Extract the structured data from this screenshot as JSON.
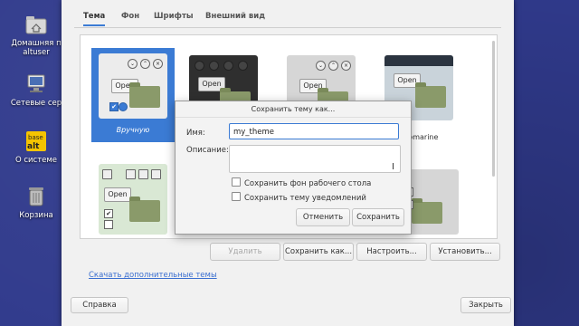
{
  "desktop": {
    "icons": [
      {
        "label": "Домашняя п",
        "label2": "altuser",
        "icon": "home-folder-icon"
      },
      {
        "label": "Сетевые сер",
        "icon": "network-icon"
      },
      {
        "label": "О системе",
        "icon": "basealt-logo-icon",
        "logo_text": "base alt"
      },
      {
        "label": "Корзина",
        "icon": "trash-icon"
      }
    ]
  },
  "tabs": [
    {
      "label": "Тема",
      "active": true
    },
    {
      "label": "Фон"
    },
    {
      "label": "Шрифты"
    },
    {
      "label": "Внешний вид"
    }
  ],
  "themes": [
    {
      "name": "Вручную",
      "selected": true,
      "open_label": "Open"
    },
    {
      "name": "",
      "open_label": "Open"
    },
    {
      "name": "",
      "open_label": "Open"
    },
    {
      "name": "Submarine",
      "open_label": "Open"
    },
    {
      "name": "",
      "open_label": "Open"
    }
  ],
  "actions": {
    "delete": "Удалить",
    "save_as": "Сохранить как...",
    "customize": "Настроить...",
    "install": "Установить..."
  },
  "more_themes_link": "Скачать дополнительные темы",
  "footer": {
    "help": "Справка",
    "close": "Закрыть"
  },
  "dialog": {
    "title": "Сохранить тему как...",
    "name_label": "Имя:",
    "name_value": "my_theme",
    "description_label": "Описание:",
    "description_value": "",
    "save_background_label": "Сохранить фон рабочего стола",
    "save_notification_label": "Сохранить тему уведомлений",
    "cancel": "Отменить",
    "save": "Сохранить"
  },
  "colors": {
    "accent": "#3b7bd4",
    "desktop": "#303a8c"
  }
}
